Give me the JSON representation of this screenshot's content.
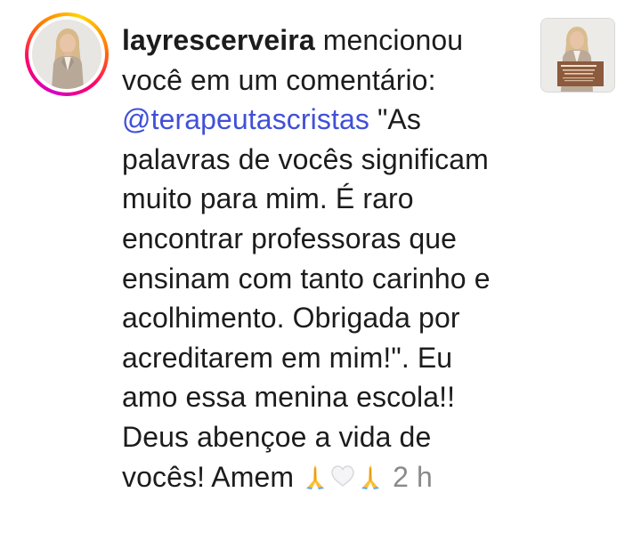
{
  "notification": {
    "username": "layrescerveira",
    "action_text": "mencionou você em um comentário:",
    "mention": "@terapeutascristas",
    "comment_text": "\"As palavras de vocês significam muito para mim. É raro encontrar professoras que ensinam com tanto carinho e acolhimento. Obrigada por acreditarem em mim!\". Eu amo essa menina escola!! Deus abençoe a vida de vocês! Amem",
    "emojis": [
      "folded-hands-icon",
      "white-heart-icon",
      "folded-hands-icon"
    ],
    "timestamp": "2 h"
  },
  "colors": {
    "text": "#1c1c1c",
    "mention": "#4150d8",
    "timestamp": "#8a8a8a",
    "story_ring": [
      "#d300c5",
      "#ff0069",
      "#ff7a00",
      "#ffd600"
    ]
  },
  "avatar": {
    "icon": "profile-photo"
  },
  "post_thumbnail": {
    "icon": "post-thumbnail"
  }
}
